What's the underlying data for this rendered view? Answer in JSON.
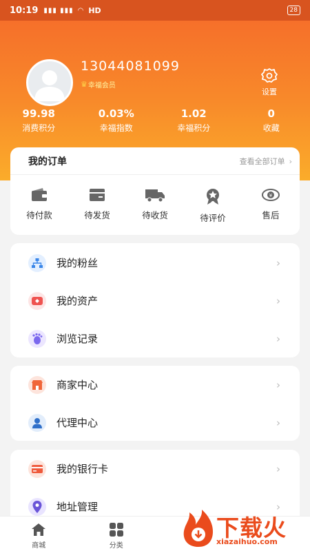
{
  "status_bar": {
    "time": "10:19",
    "network": "HD",
    "battery": "28"
  },
  "profile": {
    "username": "13044081099",
    "member_level": "幸福会员",
    "settings_label": "设置"
  },
  "stats": [
    {
      "value": "99.98",
      "label": "消费积分"
    },
    {
      "value": "0.03%",
      "label": "幸福指数"
    },
    {
      "value": "1.02",
      "label": "幸福积分"
    },
    {
      "value": "0",
      "label": "收藏"
    }
  ],
  "orders": {
    "title": "我的订单",
    "view_all": "查看全部订单",
    "items": [
      {
        "label": "待付款",
        "icon": "wallet-icon"
      },
      {
        "label": "待发货",
        "icon": "box-icon"
      },
      {
        "label": "待收货",
        "icon": "truck-icon"
      },
      {
        "label": "待评价",
        "icon": "badge-icon"
      },
      {
        "label": "售后",
        "icon": "service-icon"
      }
    ]
  },
  "menu_group1": [
    {
      "label": "我的粉丝",
      "icon": "network-icon"
    },
    {
      "label": "我的资产",
      "icon": "assets-icon"
    },
    {
      "label": "浏览记录",
      "icon": "footprint-icon"
    }
  ],
  "menu_group2": [
    {
      "label": "商家中心",
      "icon": "store-icon"
    },
    {
      "label": "代理中心",
      "icon": "agent-icon"
    }
  ],
  "menu_group3": [
    {
      "label": "我的银行卡",
      "icon": "bank-card-icon"
    },
    {
      "label": "地址管理",
      "icon": "location-icon"
    }
  ],
  "tabbar": [
    {
      "label": "商城",
      "icon": "home-icon"
    },
    {
      "label": "分类",
      "icon": "category-icon"
    }
  ],
  "watermark": {
    "brand": "下载火",
    "domain": "xiazaihuo.com"
  },
  "colors": {
    "header_top": "#f5692a",
    "header_bottom": "#fbac2a",
    "accent_red": "#ea4b1c"
  }
}
